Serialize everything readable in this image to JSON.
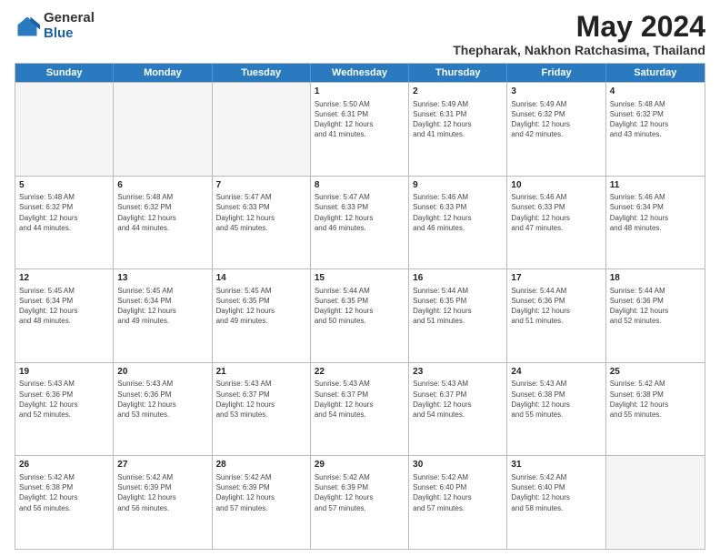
{
  "logo": {
    "general": "General",
    "blue": "Blue"
  },
  "title": "May 2024",
  "subtitle": "Thepharak, Nakhon Ratchasima, Thailand",
  "days": [
    "Sunday",
    "Monday",
    "Tuesday",
    "Wednesday",
    "Thursday",
    "Friday",
    "Saturday"
  ],
  "weeks": [
    [
      {
        "day": "",
        "text": "",
        "empty": true
      },
      {
        "day": "",
        "text": "",
        "empty": true
      },
      {
        "day": "",
        "text": "",
        "empty": true
      },
      {
        "day": "1",
        "text": "Sunrise: 5:50 AM\nSunset: 6:31 PM\nDaylight: 12 hours\nand 41 minutes."
      },
      {
        "day": "2",
        "text": "Sunrise: 5:49 AM\nSunset: 6:31 PM\nDaylight: 12 hours\nand 41 minutes."
      },
      {
        "day": "3",
        "text": "Sunrise: 5:49 AM\nSunset: 6:32 PM\nDaylight: 12 hours\nand 42 minutes."
      },
      {
        "day": "4",
        "text": "Sunrise: 5:48 AM\nSunset: 6:32 PM\nDaylight: 12 hours\nand 43 minutes."
      }
    ],
    [
      {
        "day": "5",
        "text": "Sunrise: 5:48 AM\nSunset: 6:32 PM\nDaylight: 12 hours\nand 44 minutes."
      },
      {
        "day": "6",
        "text": "Sunrise: 5:48 AM\nSunset: 6:32 PM\nDaylight: 12 hours\nand 44 minutes."
      },
      {
        "day": "7",
        "text": "Sunrise: 5:47 AM\nSunset: 6:33 PM\nDaylight: 12 hours\nand 45 minutes."
      },
      {
        "day": "8",
        "text": "Sunrise: 5:47 AM\nSunset: 6:33 PM\nDaylight: 12 hours\nand 46 minutes."
      },
      {
        "day": "9",
        "text": "Sunrise: 5:46 AM\nSunset: 6:33 PM\nDaylight: 12 hours\nand 46 minutes."
      },
      {
        "day": "10",
        "text": "Sunrise: 5:46 AM\nSunset: 6:33 PM\nDaylight: 12 hours\nand 47 minutes."
      },
      {
        "day": "11",
        "text": "Sunrise: 5:46 AM\nSunset: 6:34 PM\nDaylight: 12 hours\nand 48 minutes."
      }
    ],
    [
      {
        "day": "12",
        "text": "Sunrise: 5:45 AM\nSunset: 6:34 PM\nDaylight: 12 hours\nand 48 minutes."
      },
      {
        "day": "13",
        "text": "Sunrise: 5:45 AM\nSunset: 6:34 PM\nDaylight: 12 hours\nand 49 minutes."
      },
      {
        "day": "14",
        "text": "Sunrise: 5:45 AM\nSunset: 6:35 PM\nDaylight: 12 hours\nand 49 minutes."
      },
      {
        "day": "15",
        "text": "Sunrise: 5:44 AM\nSunset: 6:35 PM\nDaylight: 12 hours\nand 50 minutes."
      },
      {
        "day": "16",
        "text": "Sunrise: 5:44 AM\nSunset: 6:35 PM\nDaylight: 12 hours\nand 51 minutes."
      },
      {
        "day": "17",
        "text": "Sunrise: 5:44 AM\nSunset: 6:36 PM\nDaylight: 12 hours\nand 51 minutes."
      },
      {
        "day": "18",
        "text": "Sunrise: 5:44 AM\nSunset: 6:36 PM\nDaylight: 12 hours\nand 52 minutes."
      }
    ],
    [
      {
        "day": "19",
        "text": "Sunrise: 5:43 AM\nSunset: 6:36 PM\nDaylight: 12 hours\nand 52 minutes."
      },
      {
        "day": "20",
        "text": "Sunrise: 5:43 AM\nSunset: 6:36 PM\nDaylight: 12 hours\nand 53 minutes."
      },
      {
        "day": "21",
        "text": "Sunrise: 5:43 AM\nSunset: 6:37 PM\nDaylight: 12 hours\nand 53 minutes."
      },
      {
        "day": "22",
        "text": "Sunrise: 5:43 AM\nSunset: 6:37 PM\nDaylight: 12 hours\nand 54 minutes."
      },
      {
        "day": "23",
        "text": "Sunrise: 5:43 AM\nSunset: 6:37 PM\nDaylight: 12 hours\nand 54 minutes."
      },
      {
        "day": "24",
        "text": "Sunrise: 5:43 AM\nSunset: 6:38 PM\nDaylight: 12 hours\nand 55 minutes."
      },
      {
        "day": "25",
        "text": "Sunrise: 5:42 AM\nSunset: 6:38 PM\nDaylight: 12 hours\nand 55 minutes."
      }
    ],
    [
      {
        "day": "26",
        "text": "Sunrise: 5:42 AM\nSunset: 6:38 PM\nDaylight: 12 hours\nand 56 minutes."
      },
      {
        "day": "27",
        "text": "Sunrise: 5:42 AM\nSunset: 6:39 PM\nDaylight: 12 hours\nand 56 minutes."
      },
      {
        "day": "28",
        "text": "Sunrise: 5:42 AM\nSunset: 6:39 PM\nDaylight: 12 hours\nand 57 minutes."
      },
      {
        "day": "29",
        "text": "Sunrise: 5:42 AM\nSunset: 6:39 PM\nDaylight: 12 hours\nand 57 minutes."
      },
      {
        "day": "30",
        "text": "Sunrise: 5:42 AM\nSunset: 6:40 PM\nDaylight: 12 hours\nand 57 minutes."
      },
      {
        "day": "31",
        "text": "Sunrise: 5:42 AM\nSunset: 6:40 PM\nDaylight: 12 hours\nand 58 minutes."
      },
      {
        "day": "",
        "text": "",
        "empty": true
      }
    ]
  ]
}
